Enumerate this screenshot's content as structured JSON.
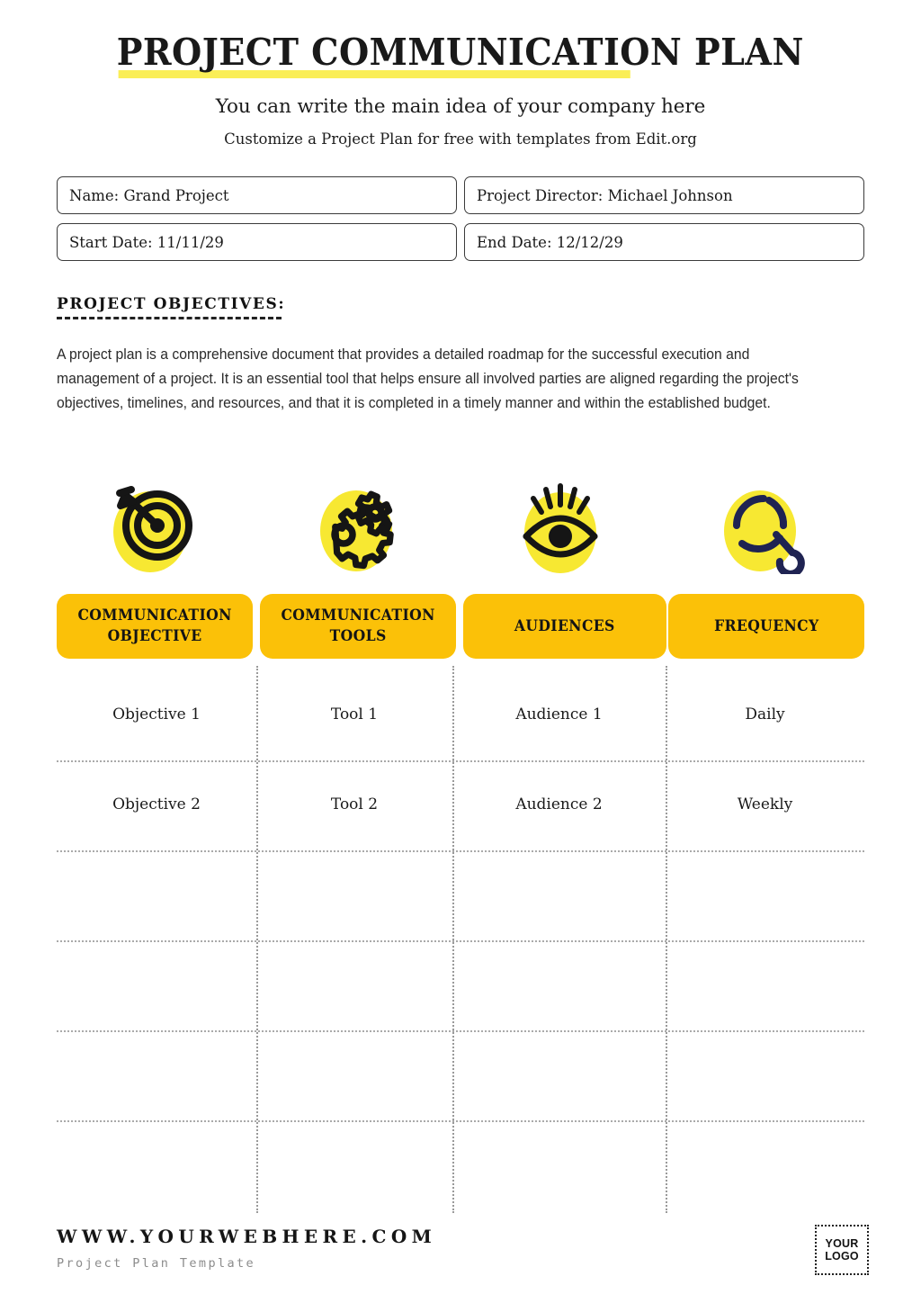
{
  "document": {
    "title": "PROJECT COMMUNICATION PLAN",
    "subtitle": "You can write the main idea of your company here",
    "tagline": "Customize a Project Plan for free with templates from Edit.org"
  },
  "fields": [
    {
      "name": "project-name-field",
      "value": "Name: Grand Project"
    },
    {
      "name": "project-director-field",
      "value": "Project Director: Michael Johnson"
    },
    {
      "name": "start-date-field",
      "value": "Start Date: 11/11/29"
    },
    {
      "name": "end-date-field",
      "value": "End Date: 12/12/29"
    }
  ],
  "objectives": {
    "heading": "PROJECT OBJECTIVES:",
    "body": "A project plan is a comprehensive document that provides a detailed roadmap for the successful execution and management of a project. It is an essential tool that helps ensure all involved parties are aligned regarding the project's objectives, timelines, and resources, and that it is completed in a timely manner and within the established budget."
  },
  "icons": [
    {
      "name": "target-icon",
      "label": "target"
    },
    {
      "name": "gears-icon",
      "label": "gears"
    },
    {
      "name": "eye-icon",
      "label": "eye"
    },
    {
      "name": "magnifier-icon",
      "label": "magnifier"
    }
  ],
  "table": {
    "headers": [
      {
        "line1": "COMMUNICATION",
        "line2": "OBJECTIVE"
      },
      {
        "line1": "COMMUNICATION",
        "line2": "TOOLS"
      },
      {
        "line1": "AUDIENCES",
        "line2": ""
      },
      {
        "line1": "FREQUENCY",
        "line2": ""
      }
    ],
    "rows": [
      [
        "Objective 1",
        "Tool 1",
        "Audience 1",
        "Daily"
      ],
      [
        "Objective 2",
        "Tool 2",
        "Audience 2",
        "Weekly"
      ],
      [
        "",
        "",
        "",
        ""
      ],
      [
        "",
        "",
        "",
        ""
      ],
      [
        "",
        "",
        "",
        ""
      ],
      [
        "",
        "",
        "",
        ""
      ]
    ]
  },
  "footer": {
    "website": "WWW.YOURWEBHERE.COM",
    "subtitle": "Project Plan Template",
    "logo_line1": "YOUR",
    "logo_line2": "LOGO"
  },
  "colors": {
    "title_underline": "#FAEE56",
    "pill_amber": "#FBC108",
    "icon_yellow": "#F7E832",
    "icon_dark": "#151515",
    "icon_navy": "#1F2352"
  }
}
